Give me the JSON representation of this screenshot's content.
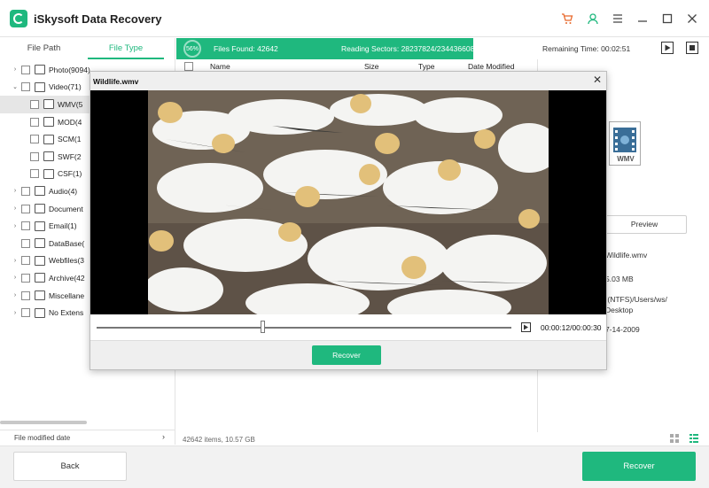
{
  "app": {
    "title": "iSkysoft Data Recovery"
  },
  "tabs": {
    "file_path": "File Path",
    "file_type": "File Type"
  },
  "tree": {
    "items": [
      {
        "arrow": "›",
        "label": "Photo(9094)",
        "selected": false
      },
      {
        "arrow": "⌄",
        "label": "Video(71)",
        "selected": false
      },
      {
        "arrow": "",
        "label": "WMV(5",
        "selected": true,
        "child": true
      },
      {
        "arrow": "",
        "label": "MOD(4",
        "selected": false,
        "child": true
      },
      {
        "arrow": "",
        "label": "SCM(1",
        "selected": false,
        "child": true
      },
      {
        "arrow": "",
        "label": "SWF(2",
        "selected": false,
        "child": true
      },
      {
        "arrow": "",
        "label": "CSF(1)",
        "selected": false,
        "child": true
      },
      {
        "arrow": "›",
        "label": "Audio(4)",
        "selected": false
      },
      {
        "arrow": "›",
        "label": "Document",
        "selected": false
      },
      {
        "arrow": "›",
        "label": "Email(1)",
        "selected": false
      },
      {
        "arrow": "",
        "label": "DataBase(",
        "selected": false
      },
      {
        "arrow": "›",
        "label": "Webfiles(3",
        "selected": false
      },
      {
        "arrow": "›",
        "label": "Archive(42",
        "selected": false
      },
      {
        "arrow": "›",
        "label": "Miscellane",
        "selected": false
      },
      {
        "arrow": "›",
        "label": "No Extens",
        "selected": false
      }
    ],
    "footer_label": "File modified date"
  },
  "scan": {
    "percent": "56%",
    "files_found": "Files Found:  42642",
    "reading_sectors": "Reading Sectors:  28237824/234436608",
    "remaining_time": "Remaining Time: 00:02:51"
  },
  "table": {
    "columns": {
      "name": "Name",
      "size": "Size",
      "type": "Type",
      "date": "Date Modified"
    },
    "items_count": "42642 items, 10.57  GB"
  },
  "details": {
    "icon_label": "WMV",
    "preview_label": "Preview",
    "filename": "Wildlife.wmv",
    "size": "5.03  MB",
    "path_line1": ":(NTFS)/Users/ws/",
    "path_line2": "Desktop",
    "date": "7-14-2009"
  },
  "bottom": {
    "back_label": "Back",
    "recover_label": "Recover"
  },
  "modal": {
    "title": "Wildlife.wmv",
    "time": "00:00:12/00:00:30",
    "recover_label": "Recover",
    "seek_fraction": 0.4
  },
  "colors": {
    "accent": "#1fb87e",
    "cart": "#e8682a"
  }
}
